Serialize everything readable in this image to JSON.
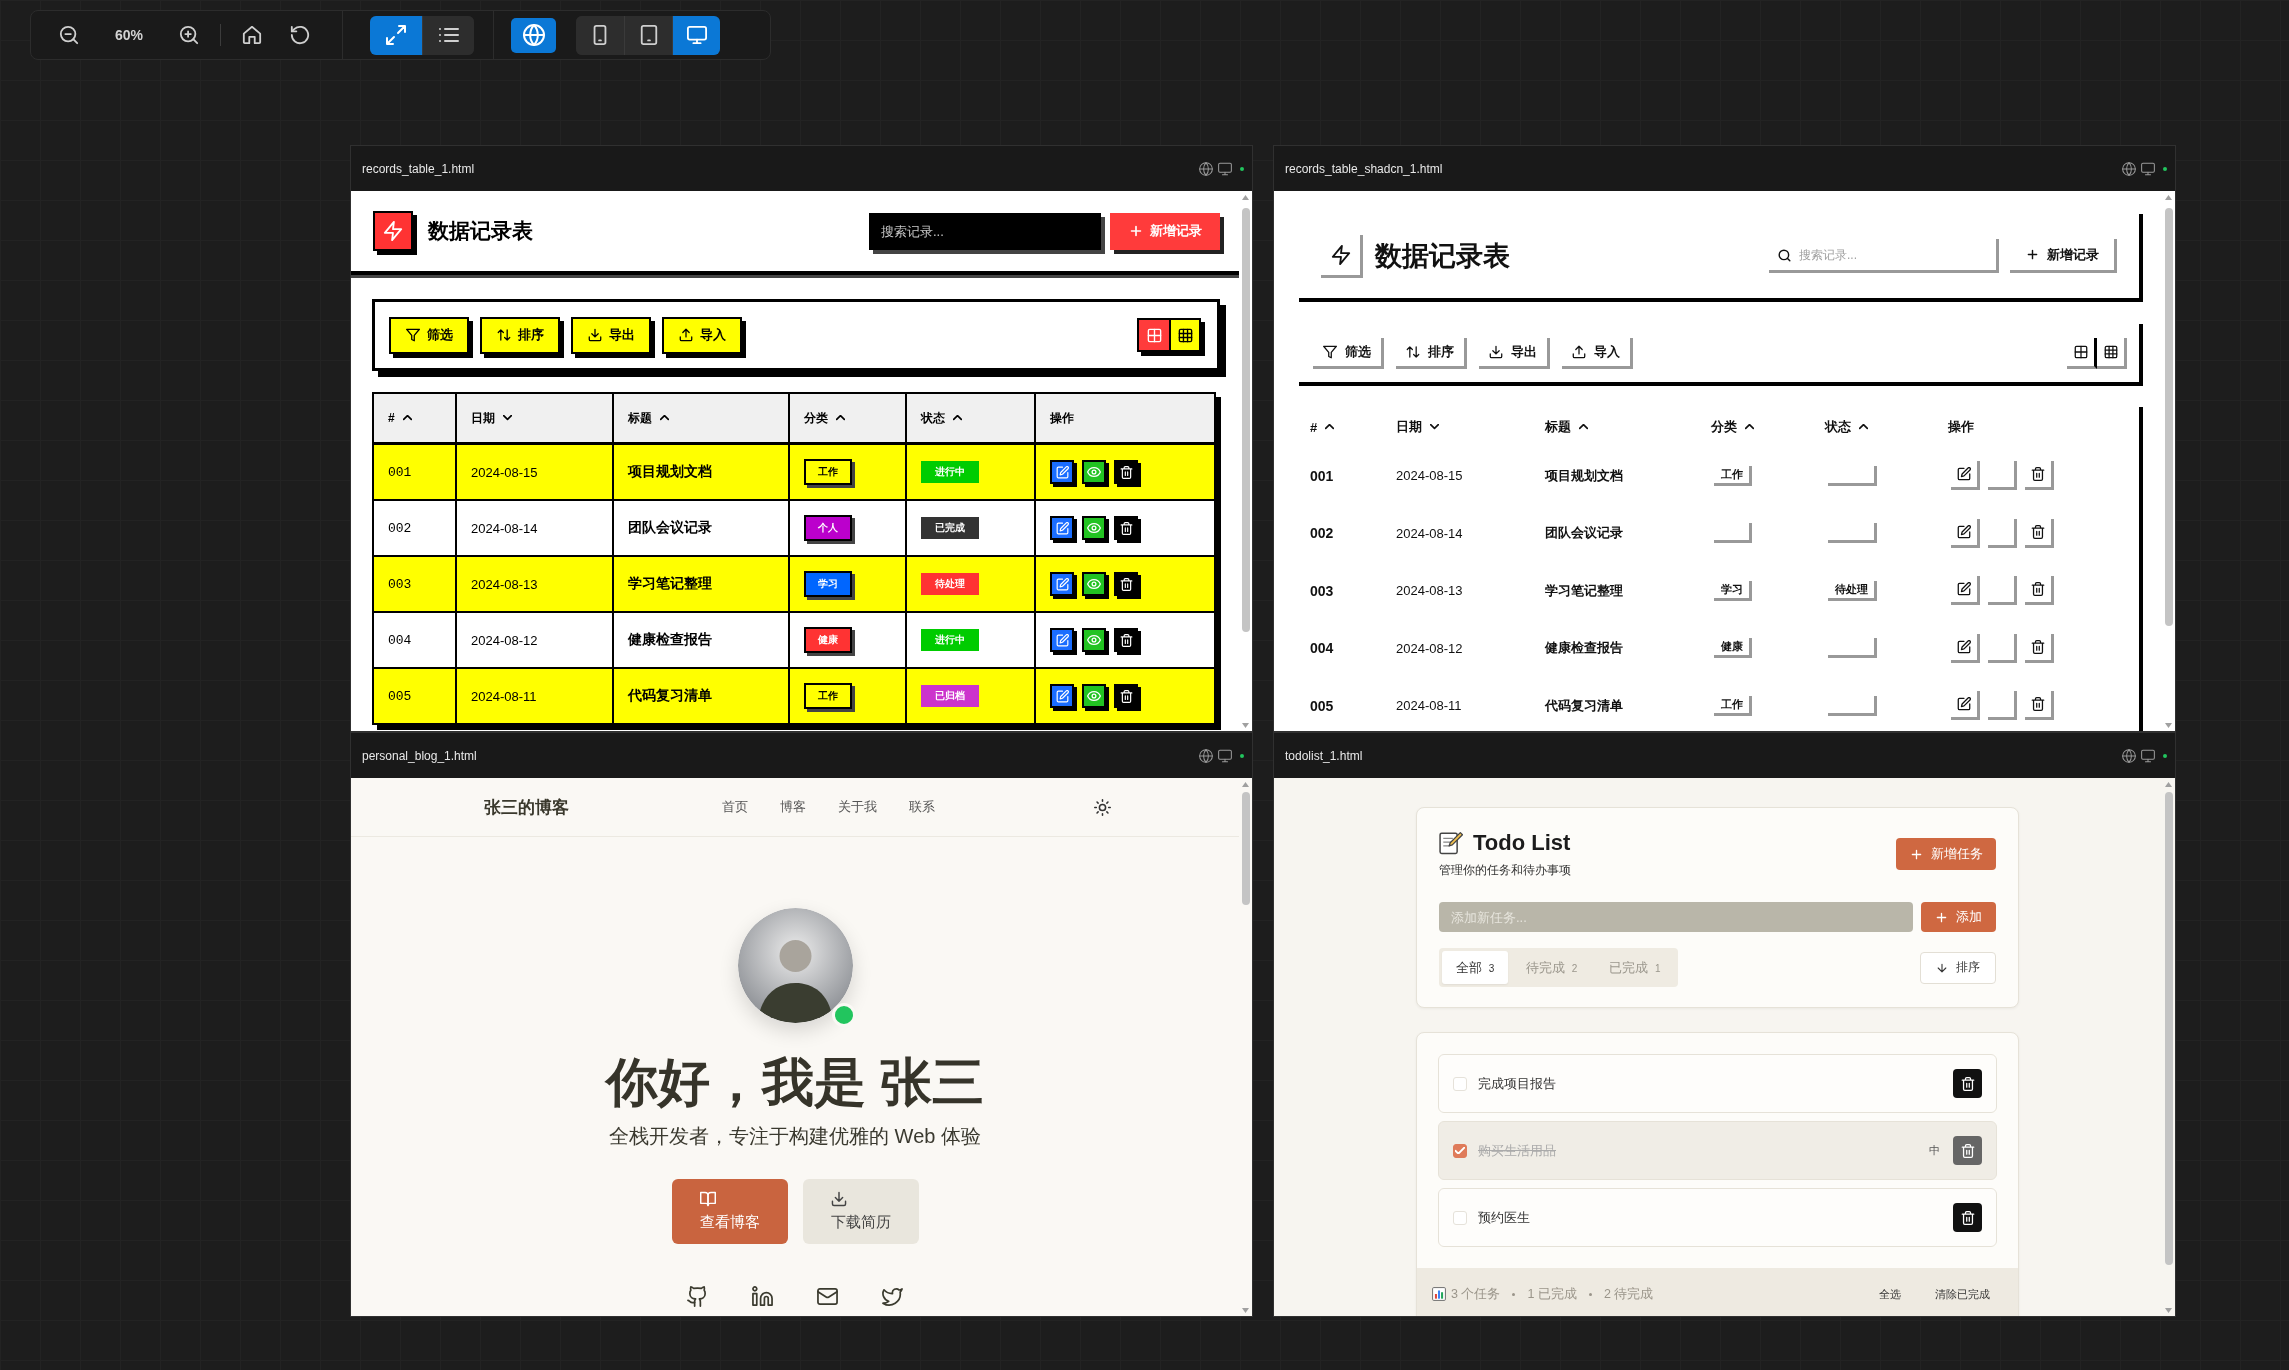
{
  "toolbar": {
    "zoom": "60%",
    "view_modes": [
      {
        "kind": "fit",
        "selected": true
      },
      {
        "kind": "list",
        "selected": false
      }
    ],
    "globe": {
      "on": true
    },
    "devices": [
      {
        "kind": "phone",
        "selected": false
      },
      {
        "kind": "tablet",
        "selected": false
      },
      {
        "kind": "desktop",
        "selected": true
      }
    ]
  },
  "panels": [
    {
      "kind": "records_brutal",
      "file": "records_table_1.html",
      "title": "数据记录表",
      "search": {
        "placeholder": "搜索记录..."
      },
      "add_button": "新增记录",
      "actions": [
        {
          "kind": "filter",
          "label": "筛选"
        },
        {
          "kind": "sort",
          "label": "排序"
        },
        {
          "kind": "export",
          "label": "导出"
        },
        {
          "kind": "import",
          "label": "导入"
        }
      ],
      "views": [
        {
          "kind": "table",
          "selected": true
        },
        {
          "kind": "grid",
          "selected": false
        }
      ],
      "columns": [
        {
          "label": "#",
          "sortable": true,
          "descending": false
        },
        {
          "label": "日期",
          "sortable": true,
          "descending": true
        },
        {
          "label": "标题",
          "sortable": true,
          "descending": false
        },
        {
          "label": "分类",
          "sortable": true,
          "descending": false
        },
        {
          "label": "状态",
          "sortable": true,
          "descending": false
        },
        {
          "label": "操作",
          "sortable": false
        }
      ],
      "rows": [
        {
          "no": "001",
          "date": "2024-08-15",
          "title": "项目规划文档",
          "category": {
            "label": "工作",
            "color": "#ffff00"
          },
          "status": {
            "label": "进行中",
            "color": "#00cc00"
          }
        },
        {
          "no": "002",
          "date": "2024-08-14",
          "title": "团队会议记录",
          "category": {
            "label": "个人",
            "color": "#bb00cc"
          },
          "status": {
            "label": "已完成",
            "color": "#333333"
          }
        },
        {
          "no": "003",
          "date": "2024-08-13",
          "title": "学习笔记整理",
          "category": {
            "label": "学习",
            "color": "#0066ff"
          },
          "status": {
            "label": "待处理",
            "color": "#ff3333"
          }
        },
        {
          "no": "004",
          "date": "2024-08-12",
          "title": "健康检查报告",
          "category": {
            "label": "健康",
            "color": "#ff3333"
          },
          "status": {
            "label": "进行中",
            "color": "#00cc00"
          }
        },
        {
          "no": "005",
          "date": "2024-08-11",
          "title": "代码复习清单",
          "category": {
            "label": "工作",
            "color": "#ffff00"
          },
          "status": {
            "label": "已归档",
            "color": "#cc33cc"
          }
        }
      ]
    },
    {
      "kind": "records_shadcn",
      "file": "records_table_shadcn_1.html",
      "title": "数据记录表",
      "search": {
        "placeholder": "搜索记录..."
      },
      "add_button": "新增记录",
      "actions": [
        {
          "kind": "filter",
          "label": "筛选"
        },
        {
          "kind": "sort",
          "label": "排序"
        },
        {
          "kind": "export",
          "label": "导出"
        },
        {
          "kind": "import",
          "label": "导入"
        }
      ],
      "views": [
        {
          "kind": "table"
        },
        {
          "kind": "grid"
        }
      ],
      "columns": [
        {
          "label": "#",
          "sortable": true,
          "descending": false
        },
        {
          "label": "日期",
          "sortable": true,
          "descending": true
        },
        {
          "label": "标题",
          "sortable": true,
          "descending": false
        },
        {
          "label": "分类",
          "sortable": true,
          "descending": false
        },
        {
          "label": "状态",
          "sortable": true,
          "descending": false
        },
        {
          "label": "操作",
          "sortable": false
        }
      ],
      "rows": [
        {
          "no": "001",
          "date": "2024-08-15",
          "title": "项目规划文档",
          "category": "工作"
        },
        {
          "no": "002",
          "date": "2024-08-14",
          "title": "团队会议记录"
        },
        {
          "no": "003",
          "date": "2024-08-13",
          "title": "学习笔记整理",
          "category": "学习",
          "status": "待处理"
        },
        {
          "no": "004",
          "date": "2024-08-12",
          "title": "健康检查报告",
          "category": "健康"
        },
        {
          "no": "005",
          "date": "2024-08-11",
          "title": "代码复习清单",
          "category": "工作"
        }
      ]
    },
    {
      "kind": "blog",
      "file": "personal_blog_1.html",
      "brand": "张三的博客",
      "nav": [
        "首页",
        "博客",
        "关于我",
        "联系"
      ],
      "profile": {
        "online": true
      },
      "heading": "你好，我是 张三",
      "tagline": "全栈开发者，专注于构建优雅的 Web 体验",
      "buttons": [
        {
          "kind": "primary",
          "label": "查看博客"
        },
        {
          "kind": "secondary",
          "label": "下载简历"
        }
      ],
      "socials": [
        {
          "kind": "github"
        },
        {
          "kind": "linkedin"
        },
        {
          "kind": "mail"
        },
        {
          "kind": "twitter"
        }
      ]
    },
    {
      "kind": "todo",
      "file": "todolist_1.html",
      "title": "Todo List",
      "subtitle": "管理你的任务和待办事项",
      "new_button": "新增任务",
      "input": {
        "placeholder": "添加新任务..."
      },
      "add_button": "添加",
      "filters": [
        {
          "label": "全部",
          "count": "3",
          "selected": true
        },
        {
          "label": "待完成",
          "count": "2",
          "selected": false
        },
        {
          "label": "已完成",
          "count": "1",
          "selected": false
        }
      ],
      "sort_button": "排序",
      "tasks": [
        {
          "text": "完成项目报告",
          "checked": false
        },
        {
          "text": "购买生活用品",
          "checked": true,
          "priority": "中"
        },
        {
          "text": "预约医生",
          "checked": false
        }
      ],
      "footer": {
        "stats": [
          "3 个任务",
          "1 已完成",
          "2 待完成"
        ],
        "select_all": "全选",
        "clear_completed": "清除已完成"
      }
    }
  ]
}
